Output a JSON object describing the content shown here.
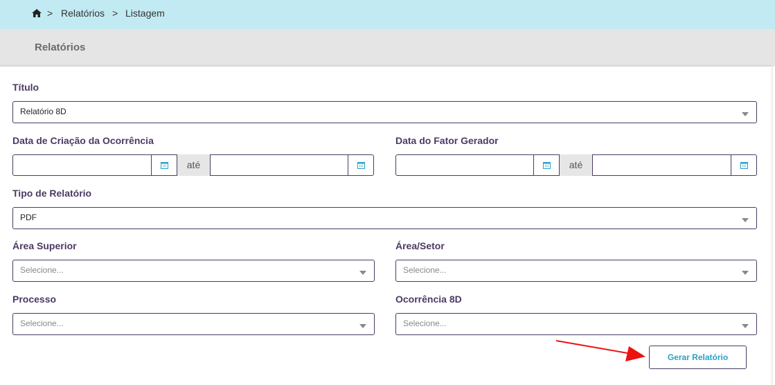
{
  "breadcrumb": {
    "items": [
      "Relatórios",
      "Listagem"
    ],
    "separator": ">"
  },
  "header": {
    "title": "Relatórios"
  },
  "form": {
    "titulo": {
      "label": "Título",
      "value": "Relatório 8D"
    },
    "data_criacao": {
      "label": "Data de Criação da Ocorrência",
      "sep": "até",
      "from": "",
      "to": ""
    },
    "data_fator": {
      "label": "Data do Fator Gerador",
      "sep": "até",
      "from": "",
      "to": ""
    },
    "tipo": {
      "label": "Tipo de Relatório",
      "value": "PDF"
    },
    "area_superior": {
      "label": "Área Superior",
      "placeholder": "Selecione..."
    },
    "area_setor": {
      "label": "Área/Setor",
      "placeholder": "Selecione..."
    },
    "processo": {
      "label": "Processo",
      "placeholder": "Selecione..."
    },
    "ocorrencia": {
      "label": "Ocorrência 8D",
      "placeholder": "Selecione..."
    }
  },
  "actions": {
    "generate_label": "Gerar Relatório"
  },
  "colors": {
    "breadcrumb_bg": "#c2eaf2",
    "header_bg": "#e5e5e5",
    "label": "#4b3a62",
    "button_text": "#2aa1c5",
    "annotation_arrow": "#ee1111"
  },
  "icons": [
    "home-icon",
    "calendar-icon",
    "chevron-down-icon",
    "red-annotation-arrow"
  ]
}
